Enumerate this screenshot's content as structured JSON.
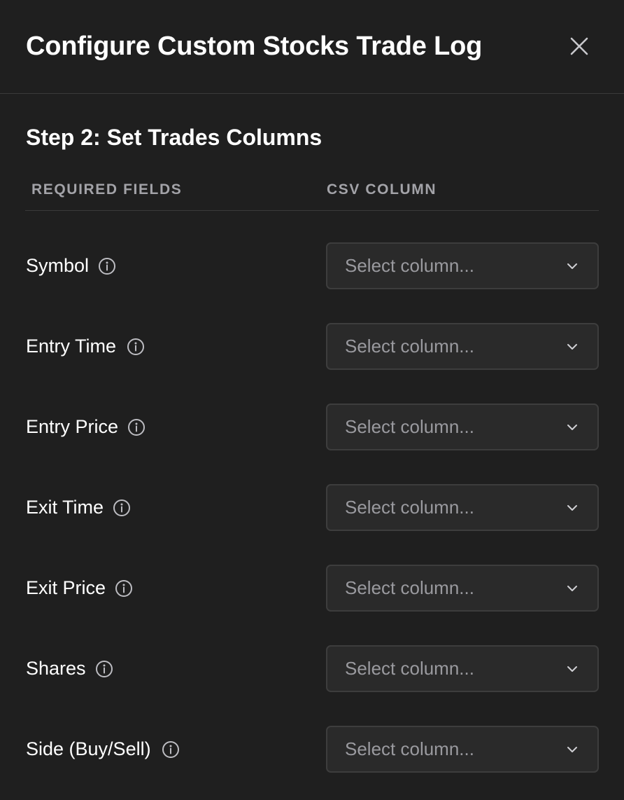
{
  "modal": {
    "title": "Configure Custom Stocks Trade Log",
    "close_icon": "close-icon"
  },
  "step": {
    "title": "Step 2: Set Trades Columns"
  },
  "columns": {
    "required_fields": "REQUIRED FIELDS",
    "csv_column": "CSV COLUMN"
  },
  "fields": [
    {
      "label": "Symbol",
      "icon": "info-icon",
      "select_placeholder": "Select column..."
    },
    {
      "label": "Entry Time",
      "icon": "info-icon",
      "select_placeholder": "Select column..."
    },
    {
      "label": "Entry Price",
      "icon": "info-icon",
      "select_placeholder": "Select column..."
    },
    {
      "label": "Exit Time",
      "icon": "info-icon",
      "select_placeholder": "Select column..."
    },
    {
      "label": "Exit Price",
      "icon": "info-icon",
      "select_placeholder": "Select column..."
    },
    {
      "label": "Shares",
      "icon": "info-icon",
      "select_placeholder": "Select column..."
    },
    {
      "label": "Side (Buy/Sell)",
      "icon": "info-icon",
      "select_placeholder": "Select column..."
    }
  ],
  "colors": {
    "background": "#1f1f1f",
    "select_background": "#2a2a2a",
    "select_border": "#3d3d3d",
    "divider": "#3a3a3a",
    "text_primary": "#ffffff",
    "text_muted": "#a3a3a8"
  }
}
